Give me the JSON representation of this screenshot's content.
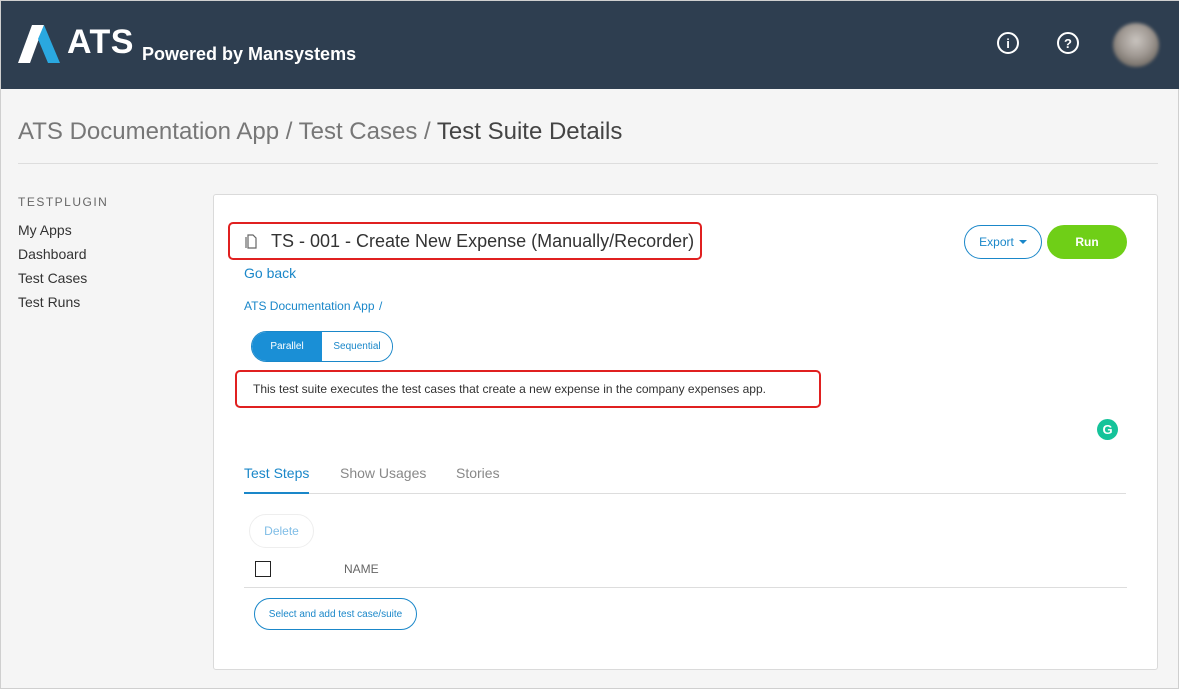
{
  "header": {
    "logo_text": "ATS",
    "logo_subtitle": "Powered by Mansystems",
    "info_icon": "info-icon",
    "help_icon": "help-icon",
    "avatar": "user-avatar"
  },
  "breadcrumb": {
    "app": "ATS Documentation App",
    "sep1": " / ",
    "section": "Test Cases",
    "sep2": " / ",
    "current": "Test Suite Details"
  },
  "sidebar": {
    "title": "TESTPLUGIN",
    "items": [
      {
        "label": "My Apps"
      },
      {
        "label": "Dashboard"
      },
      {
        "label": "Test Cases"
      },
      {
        "label": "Test Runs"
      }
    ]
  },
  "suite": {
    "title": "TS - 001 - Create New Expense (Manually/Recorder)",
    "go_back": "Go back",
    "app_path": "ATS Documentation App",
    "app_path_sep": "/",
    "export_label": "Export",
    "run_label": "Run",
    "mode": {
      "parallel": "Parallel",
      "sequential": "Sequential",
      "selected": "Parallel"
    },
    "description": "This test suite executes the test cases that create a new expense in the company expenses app."
  },
  "tabs": [
    {
      "label": "Test Steps",
      "active": true
    },
    {
      "label": "Show Usages",
      "active": false
    },
    {
      "label": "Stories",
      "active": false
    }
  ],
  "steps": {
    "delete_label": "Delete",
    "column_name": "NAME",
    "add_label": "Select and add test case/suite"
  },
  "colors": {
    "header_bg": "#2e3e50",
    "accent": "#1a87c9",
    "run_green": "#6fcf17",
    "highlight_red": "#e02020"
  }
}
